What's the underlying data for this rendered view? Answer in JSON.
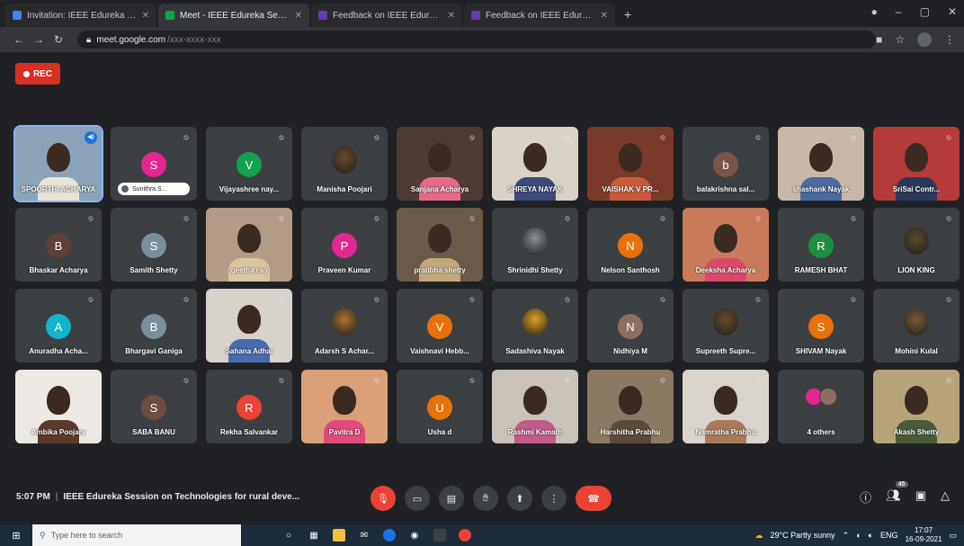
{
  "browser": {
    "tabs": [
      {
        "label": "Invitation: IEEE Edureka Session",
        "active": false,
        "color": "#4285f4"
      },
      {
        "label": "Meet - IEEE Edureka Session",
        "active": true,
        "color": "#00ac47"
      },
      {
        "label": "Feedback on IEEE Edureka Session",
        "active": false,
        "color": "#673ab7"
      },
      {
        "label": "Feedback on IEEE Edureka Session",
        "active": false,
        "color": "#673ab7"
      }
    ],
    "url": "meet.google.com",
    "url_rest": "/xxx-xxxx-xxx"
  },
  "recording_label": "REC",
  "participants": [
    {
      "name": "SPOORTHI ACHARYA",
      "type": "video",
      "speaking": true,
      "bg": "#8aa3b8",
      "shirt": "#e9e3d8"
    },
    {
      "name": "Sunithra S...",
      "type": "avatar",
      "initial": "S",
      "color": "#e52592",
      "pill": true
    },
    {
      "name": "Vijayashree nay...",
      "type": "avatar",
      "initial": "V",
      "color": "#12a150"
    },
    {
      "name": "Manisha Poojari",
      "type": "photo",
      "color": "#6b4a2b"
    },
    {
      "name": "Sanjana Acharya",
      "type": "video",
      "bg": "#4e3b33",
      "shirt": "#e36a8a"
    },
    {
      "name": "SHREYA NAYAK",
      "type": "video",
      "bg": "#d9d2c6",
      "shirt": "#3b4a7a"
    },
    {
      "name": "VAISHAK V PR...",
      "type": "video",
      "bg": "#7a3a2a",
      "shirt": "#c65a3a"
    },
    {
      "name": "balakrishna sal...",
      "type": "avatar",
      "initial": "b",
      "color": "#795548"
    },
    {
      "name": "shashank Nayak",
      "type": "video",
      "bg": "#c8b8a8",
      "shirt": "#4a6aa0"
    },
    {
      "name": "SriSai Contr...",
      "type": "video",
      "bg": "#b53a3a",
      "shirt": "#2a3a5a"
    },
    {
      "name": "Bhaskar Acharya",
      "type": "avatar",
      "initial": "B",
      "color": "#5d4037"
    },
    {
      "name": "Samith Shetty",
      "type": "avatar",
      "initial": "S",
      "color": "#78909c"
    },
    {
      "name": "geetha rao",
      "type": "video",
      "bg": "#b39c86",
      "shirt": "#d9c5a0"
    },
    {
      "name": "Praveen Kumar",
      "type": "avatar",
      "initial": "P",
      "color": "#e52592"
    },
    {
      "name": "pratibha shetty",
      "type": "video",
      "bg": "#6b5a48",
      "shirt": "#c2a87a"
    },
    {
      "name": "Shrinidhi Shetty",
      "type": "photo",
      "color": "#8a8f94"
    },
    {
      "name": "Nelson Santhosh",
      "type": "avatar",
      "initial": "N",
      "color": "#e8710a"
    },
    {
      "name": "Deeksha Acharya",
      "type": "video",
      "bg": "#c97a5a",
      "shirt": "#d94a6a"
    },
    {
      "name": "RAMESH BHAT",
      "type": "avatar",
      "initial": "R",
      "color": "#1e8e3e"
    },
    {
      "name": "LION KING",
      "type": "photo",
      "color": "#5a4a2a"
    },
    {
      "name": "Anuradha Acha...",
      "type": "avatar",
      "initial": "A",
      "color": "#12b5cb"
    },
    {
      "name": "Bhargavi Ganiga",
      "type": "avatar",
      "initial": "B",
      "color": "#78909c"
    },
    {
      "name": "Sahana Adhai",
      "type": "video",
      "bg": "#d7d2cc",
      "shirt": "#4a6ab0"
    },
    {
      "name": "Adarsh S Achar...",
      "type": "photo",
      "color": "#a8722a"
    },
    {
      "name": "Vaishnavi Hebb...",
      "type": "avatar",
      "initial": "V",
      "color": "#e8710a"
    },
    {
      "name": "Sadashiva Nayak",
      "type": "photo",
      "color": "#e0a020"
    },
    {
      "name": "Nidhiya M",
      "type": "avatar",
      "initial": "N",
      "color": "#8d6e63"
    },
    {
      "name": "Supreeth Supre...",
      "type": "photo",
      "color": "#6a4a2a"
    },
    {
      "name": "SHIVAM Nayak",
      "type": "avatar",
      "initial": "S",
      "color": "#e8710a"
    },
    {
      "name": "Mohini Kulal",
      "type": "photo",
      "color": "#7a5a3a"
    },
    {
      "name": "Ambika Poojary",
      "type": "video",
      "bg": "#ece8e4",
      "shirt": "#5a3a2a"
    },
    {
      "name": "SABA BANU",
      "type": "avatar",
      "initial": "S",
      "color": "#6d4c41"
    },
    {
      "name": "Rekha Salvankar",
      "type": "avatar",
      "initial": "R",
      "color": "#ea4335"
    },
    {
      "name": "Pavitra D",
      "type": "video",
      "bg": "#d9a07a",
      "shirt": "#e04a7a"
    },
    {
      "name": "Usha d",
      "type": "avatar",
      "initial": "U",
      "color": "#e8710a"
    },
    {
      "name": "Rashmi Kamath",
      "type": "video",
      "bg": "#c9c2b8",
      "shirt": "#c25a8a"
    },
    {
      "name": "Harshitha Prabhu",
      "type": "video",
      "bg": "#8a7a62",
      "shirt": "#5a4a3a"
    },
    {
      "name": "Namratha Prabhu",
      "type": "video",
      "bg": "#d8d4cc",
      "shirt": "#a87a5a"
    },
    {
      "name": "4 others",
      "type": "others",
      "colors": [
        "#e52592",
        "#8d6e63"
      ]
    },
    {
      "name": "Akash Shetty",
      "type": "video",
      "bg": "#b8a47a",
      "shirt": "#4a5a3a"
    }
  ],
  "meeting": {
    "time": "5:07 PM",
    "title": "IEEE Edureka Session on Technologies for rural deve...",
    "people_count": "45"
  },
  "taskbar": {
    "search_placeholder": "Type here to search",
    "weather": "29°C  Partly sunny",
    "lang": "ENG",
    "time": "17:07",
    "date": "16-09-2021"
  }
}
